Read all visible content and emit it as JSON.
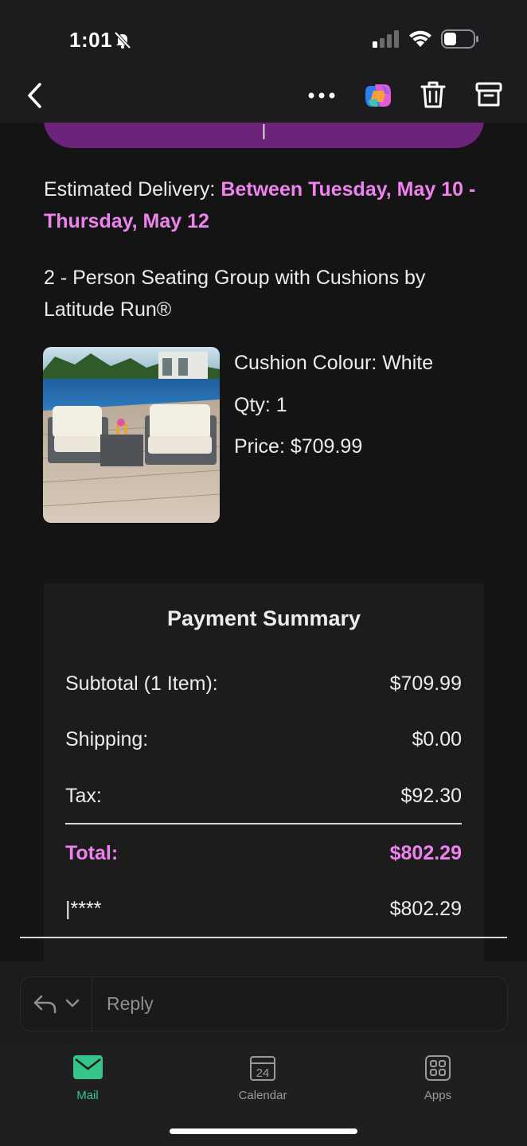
{
  "status_bar": {
    "time": "1:01"
  },
  "email": {
    "delivery_label": "Estimated Delivery:",
    "delivery_value": "Between Tuesday, May 10 - Thursday, May 12",
    "product_name": "2 - Person Seating Group with Cushions by Latitude Run®",
    "product_details": {
      "cushion": "Cushion Colour: White",
      "qty": "Qty: 1",
      "price": "Price: $709.99"
    },
    "payment_summary": {
      "title": "Payment Summary",
      "rows": [
        {
          "label": "Subtotal (1 Item):",
          "value": "$709.99"
        },
        {
          "label": "Shipping:",
          "value": "$0.00"
        },
        {
          "label": "Tax:",
          "value": "$92.30"
        },
        {
          "label": "Total:",
          "value": "$802.29"
        },
        {
          "label": "|****",
          "value": "$802.29"
        }
      ]
    }
  },
  "reply": {
    "placeholder": "Reply"
  },
  "tabs": [
    {
      "label": "Mail"
    },
    {
      "label": "Calendar",
      "date": "24"
    },
    {
      "label": "Apps"
    }
  ],
  "colors": {
    "accent_purple": "#ee82ee",
    "button_purple": "#6c2379",
    "mail_green": "#36c48a",
    "background": "#141414"
  }
}
